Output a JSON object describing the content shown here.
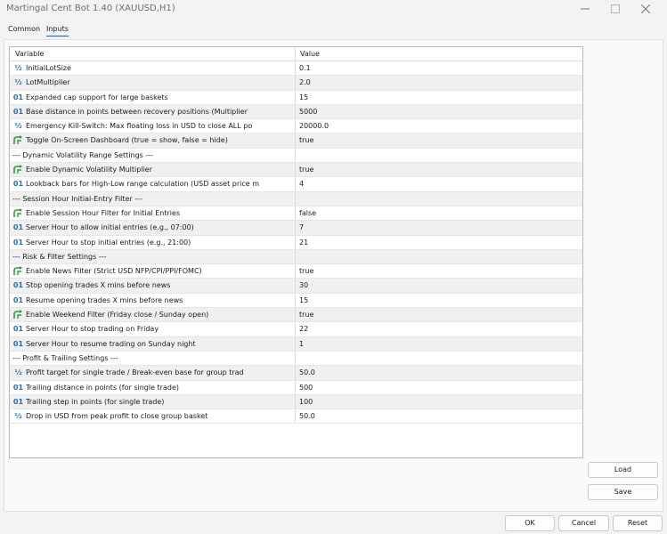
{
  "window": {
    "title": "Martingal Cent Bot 1.40 (XAUUSD,H1)"
  },
  "tabs": [
    {
      "label": "Common",
      "active": false
    },
    {
      "label": "Inputs",
      "active": true
    }
  ],
  "grid": {
    "columns": {
      "variable": "Variable",
      "value": "Value"
    },
    "rows": [
      {
        "icon": "double-icon",
        "name": "InitialLotSize",
        "value": "0.1"
      },
      {
        "icon": "double-icon",
        "name": "LotMultiplier",
        "value": "2.0"
      },
      {
        "icon": "int-icon",
        "name": "Expanded cap support for large baskets",
        "value": "15"
      },
      {
        "icon": "int-icon",
        "name": "Base distance in points between recovery positions (Multiplier",
        "value": "5000"
      },
      {
        "icon": "double-icon",
        "name": "Emergency Kill-Switch: Max floating loss in USD to close ALL po",
        "value": "20000.0"
      },
      {
        "icon": "bool-icon",
        "name": "Toggle On-Screen Dashboard (true = show, false = hide)",
        "value": "true"
      },
      {
        "icon": "",
        "name": "--- Dynamic Volatility Range Settings ---",
        "value": ""
      },
      {
        "icon": "bool-icon",
        "name": "Enable Dynamic Volatility Multiplier",
        "value": "true"
      },
      {
        "icon": "int-icon",
        "name": "Lookback bars for High-Low range calculation (USD asset price m",
        "value": "4"
      },
      {
        "icon": "",
        "name": "--- Session Hour Initial-Entry Filter ---",
        "value": ""
      },
      {
        "icon": "bool-icon",
        "name": "Enable Session Hour Filter for Initial Entries",
        "value": "false"
      },
      {
        "icon": "int-icon",
        "name": "Server Hour to allow initial entries (e.g., 07:00)",
        "value": "7"
      },
      {
        "icon": "int-icon",
        "name": "Server Hour to stop initial entries (e.g., 21:00)",
        "value": "21"
      },
      {
        "icon": "",
        "name": "--- Risk & Filter Settings ---",
        "value": ""
      },
      {
        "icon": "bool-icon",
        "name": "Enable News Filter (Strict USD NFP/CPI/PPI/FOMC)",
        "value": "true"
      },
      {
        "icon": "int-icon",
        "name": "Stop opening trades X mins before news",
        "value": "30"
      },
      {
        "icon": "int-icon",
        "name": "Resume opening trades X mins before news",
        "value": "15"
      },
      {
        "icon": "bool-icon",
        "name": "Enable Weekend Filter (Friday close / Sunday open)",
        "value": "true"
      },
      {
        "icon": "int-icon",
        "name": "Server Hour to stop trading on Friday",
        "value": "22"
      },
      {
        "icon": "int-icon",
        "name": "Server Hour to resume trading on Sunday night",
        "value": "1"
      },
      {
        "icon": "",
        "name": "--- Profit & Trailing Settings ---",
        "value": ""
      },
      {
        "icon": "double-icon",
        "name": "Profit target for single trade / Break-even base for group trad",
        "value": "50.0"
      },
      {
        "icon": "int-icon",
        "name": "Trailing distance in points (for single trade)",
        "value": "500"
      },
      {
        "icon": "int-icon",
        "name": "Trailing step in points (for single trade)",
        "value": "100"
      },
      {
        "icon": "double-icon",
        "name": "Drop in USD from peak profit to close group basket",
        "value": "50.0"
      }
    ]
  },
  "icons": {
    "int_glyph": "01",
    "double_glyph": "½"
  },
  "buttons": {
    "load": "Load",
    "save": "Save",
    "ok": "OK",
    "cancel": "Cancel",
    "reset": "Reset"
  },
  "colors": {
    "int_icon": "#1f6fb8",
    "bool_icon": "#2e9a3a",
    "accent": "#1f5fbf"
  }
}
